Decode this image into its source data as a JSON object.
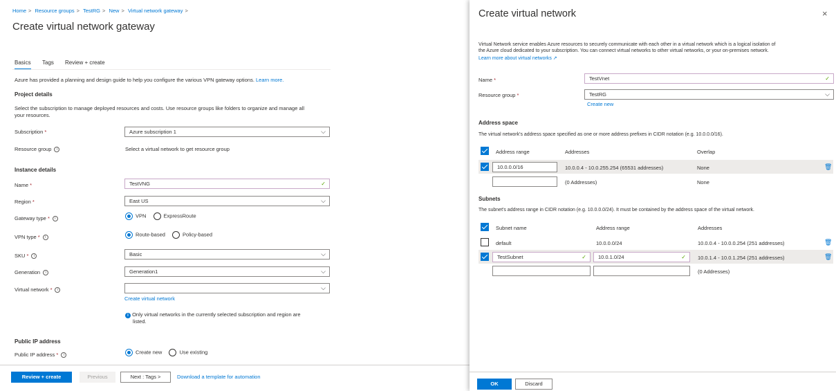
{
  "breadcrumb": [
    "Home",
    "Resource groups",
    "TestRG",
    "New",
    "Virtual network gateway"
  ],
  "left": {
    "title": "Create virtual network gateway",
    "tabs": [
      "Basics",
      "Tags",
      "Review + create"
    ],
    "intro": "Azure has provided a planning and design guide to help you configure the various VPN gateway options.",
    "learn_more": "Learn more.",
    "project_details": "Project details",
    "project_desc_1": "Select the subscription to manage deployed resources and costs. Use resource groups like folders to organize and manage all",
    "project_desc_2": "your resources.",
    "subscription_label": "Subscription",
    "subscription_value": "Azure subscription 1",
    "resource_group_label": "Resource group",
    "resource_group_value": "Select a virtual network to get resource group",
    "instance_details": "Instance details",
    "name_label": "Name",
    "name_value": "TestVNG",
    "region_label": "Region",
    "region_value": "East US",
    "gateway_type_label": "Gateway type",
    "gateway_vpn": "VPN",
    "gateway_er": "ExpressRoute",
    "vpn_type_label": "VPN type",
    "vpn_route": "Route-based",
    "vpn_policy": "Policy-based",
    "sku_label": "SKU",
    "sku_value": "Basic",
    "generation_label": "Generation",
    "generation_value": "Generation1",
    "vnet_label": "Virtual network",
    "vnet_value": "",
    "create_vnet_link": "Create virtual network",
    "vnet_note_1": "Only virtual networks in the currently selected subscription and region are",
    "vnet_note_2": "listed.",
    "public_ip_heading": "Public IP address",
    "public_ip_label": "Public IP address",
    "public_ip_new": "Create new",
    "public_ip_existing": "Use existing",
    "footer": {
      "review": "Review + create",
      "previous": "Previous",
      "next": "Next : Tags >",
      "download": "Download a template for automation"
    }
  },
  "right": {
    "title": "Create virtual network",
    "close": "×",
    "desc_1": "Virtual Network service enables Azure resources to securely communicate with each other in a virtual network which is a logical isolation of",
    "desc_2": "the Azure cloud dedicated to your subscription. You can connect virtual networks to other virtual networks, or your on-premises network.",
    "learn_more": "Learn more about virtual networks",
    "name_label": "Name",
    "name_value": "TestVnet",
    "rg_label": "Resource group",
    "rg_value": "TestRG",
    "create_new": "Create new",
    "address_space": "Address space",
    "address_desc": "The virtual network's address space specified as one or more address prefixes in CIDR notation (e.g. 10.0.0.0/16).",
    "addr_headers": [
      "Address range",
      "Addresses",
      "Overlap"
    ],
    "addr_rows": [
      {
        "range": "10.0.0.0/16",
        "addresses": "10.0.0.4 - 10.0.255.254 (65531 addresses)",
        "overlap": "None"
      },
      {
        "range": "",
        "addresses": "(0 Addresses)",
        "overlap": "None"
      }
    ],
    "subnets": "Subnets",
    "subnets_desc": "The subnet's address range in CIDR notation (e.g. 10.0.0.0/24). It must be contained by the address space of the virtual network.",
    "subnet_headers": [
      "Subnet name",
      "Address range",
      "Addresses"
    ],
    "subnet_rows": [
      {
        "name": "default",
        "range": "10.0.0.0/24",
        "addresses": "10.0.0.4 - 10.0.0.254 (251 addresses)"
      },
      {
        "name": "TestSubnet",
        "range": "10.0.1.0/24",
        "addresses": "10.0.1.4 - 10.0.1.254 (251 addresses)"
      },
      {
        "name": "",
        "range": "",
        "addresses": "(0 Addresses)"
      }
    ],
    "ok": "OK",
    "discard": "Discard"
  },
  "colors": {
    "accent": "#0078d4",
    "required": "#a4262c",
    "valid": "#57a300"
  }
}
